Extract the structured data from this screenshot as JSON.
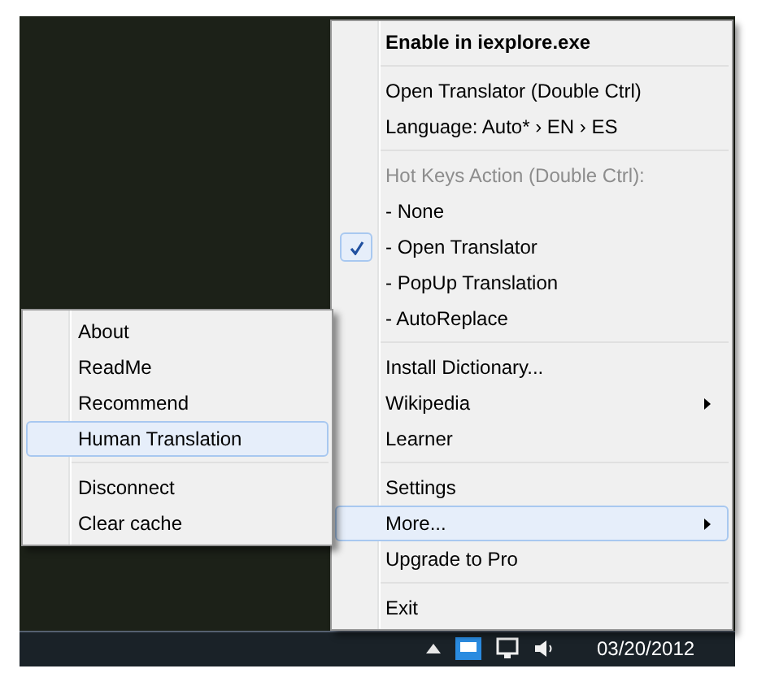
{
  "menu": {
    "items": [
      {
        "kind": "bold",
        "label": "Enable in iexplore.exe",
        "selected": false,
        "checked": false,
        "submenu": false
      },
      {
        "kind": "separator"
      },
      {
        "kind": "item",
        "label": "Open Translator (Double Ctrl)",
        "selected": false,
        "checked": false,
        "submenu": false
      },
      {
        "kind": "item",
        "label": "Language: Auto* › EN › ES",
        "selected": false,
        "checked": false,
        "submenu": false
      },
      {
        "kind": "separator"
      },
      {
        "kind": "header",
        "label": "Hot Keys Action (Double Ctrl):"
      },
      {
        "kind": "item",
        "label": "- None",
        "selected": false,
        "checked": false,
        "submenu": false
      },
      {
        "kind": "item",
        "label": "- Open Translator",
        "selected": false,
        "checked": true,
        "submenu": false
      },
      {
        "kind": "item",
        "label": "- PopUp Translation",
        "selected": false,
        "checked": false,
        "submenu": false
      },
      {
        "kind": "item",
        "label": "- AutoReplace",
        "selected": false,
        "checked": false,
        "submenu": false
      },
      {
        "kind": "separator"
      },
      {
        "kind": "item",
        "label": "Install Dictionary...",
        "selected": false,
        "checked": false,
        "submenu": false
      },
      {
        "kind": "item",
        "label": "Wikipedia",
        "selected": false,
        "checked": false,
        "submenu": true
      },
      {
        "kind": "item",
        "label": "Learner",
        "selected": false,
        "checked": false,
        "submenu": false
      },
      {
        "kind": "separator"
      },
      {
        "kind": "item",
        "label": "Settings",
        "selected": false,
        "checked": false,
        "submenu": false
      },
      {
        "kind": "item",
        "label": "More...",
        "selected": true,
        "checked": false,
        "submenu": true
      },
      {
        "kind": "item",
        "label": "Upgrade to Pro",
        "selected": false,
        "checked": false,
        "submenu": false
      },
      {
        "kind": "separator"
      },
      {
        "kind": "item",
        "label": "Exit",
        "selected": false,
        "checked": false,
        "submenu": false
      }
    ]
  },
  "submenu": {
    "items": [
      {
        "kind": "item",
        "label": "About",
        "selected": false
      },
      {
        "kind": "item",
        "label": "ReadMe",
        "selected": false
      },
      {
        "kind": "item",
        "label": "Recommend",
        "selected": false
      },
      {
        "kind": "item",
        "label": "Human Translation",
        "selected": true
      },
      {
        "kind": "separator"
      },
      {
        "kind": "item",
        "label": "Disconnect",
        "selected": false
      },
      {
        "kind": "item",
        "label": "Clear cache",
        "selected": false
      }
    ]
  },
  "taskbar": {
    "date": "03/20/2012"
  }
}
